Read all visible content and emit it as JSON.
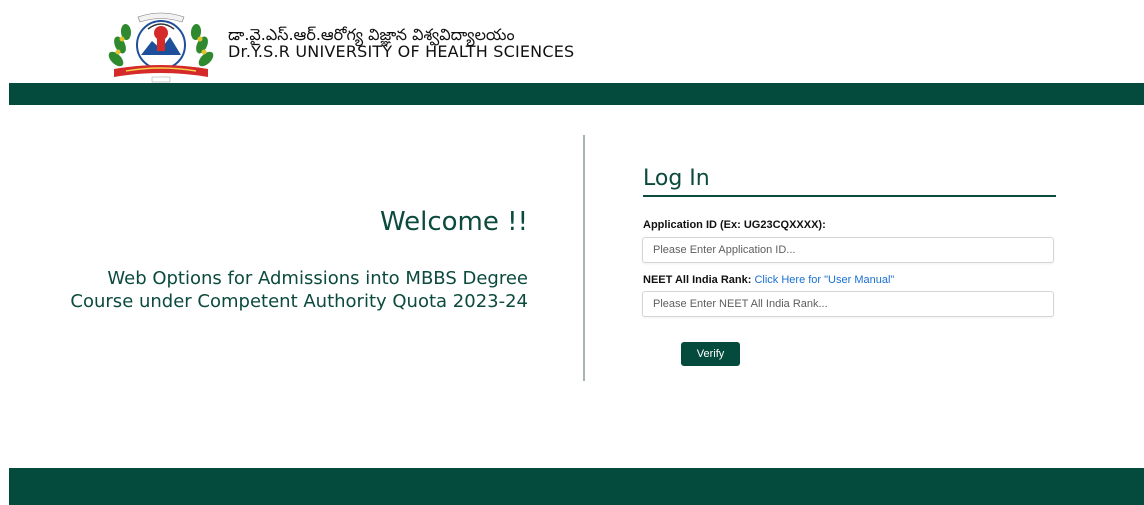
{
  "header": {
    "university_name_telugu": "డా.వై.ఎస్.ఆర్.ఆరోగ్య విజ్ఞాన విశ్వవిద్యాలయం",
    "university_name_english": "Dr.Y.S.R UNIVERSITY OF HEALTH SCIENCES",
    "logo_icon": "university-emblem-icon"
  },
  "welcome": {
    "heading": "Welcome !!",
    "subtitle": "Web Options for Admissions into MBBS Degree Course under Competent Authority Quota 2023-24"
  },
  "login": {
    "title": "Log In",
    "application_id_label": "Application ID (Ex: UG23CQXXXX):",
    "application_id_placeholder": "Please Enter Application ID...",
    "application_id_value": "",
    "neet_rank_label": "NEET All India Rank:",
    "user_manual_link": "Click Here for \"User Manual\"",
    "neet_rank_placeholder": "Please Enter NEET All India Rank...",
    "neet_rank_value": "",
    "verify_label": "Verify"
  },
  "colors": {
    "brand_green": "#044a3d",
    "heading_green": "#0b4a3c",
    "link_blue": "#1a6fd1"
  }
}
